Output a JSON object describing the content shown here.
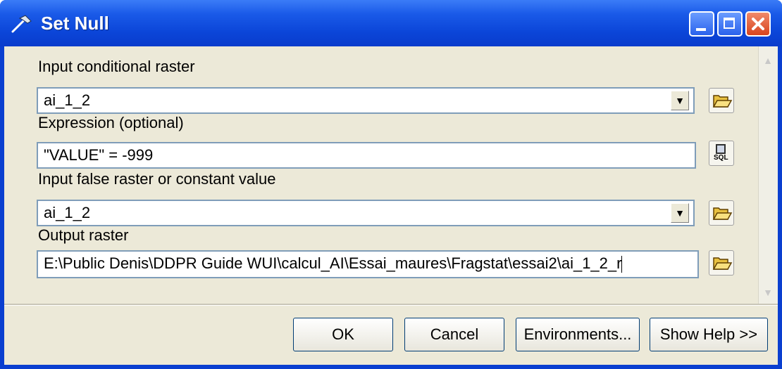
{
  "window": {
    "title": "Set Null"
  },
  "fields": {
    "input_conditional_raster": {
      "label": "Input conditional raster",
      "value": "ai_1_2"
    },
    "expression": {
      "label": "Expression (optional)",
      "value": "\"VALUE\" = -999"
    },
    "input_false_raster": {
      "label": "Input false raster or constant value",
      "value": "ai_1_2"
    },
    "output_raster": {
      "label": "Output raster",
      "value": "E:\\Public Denis\\DDPR Guide WUI\\calcul_AI\\Essai_maures\\Fragstat\\essai2\\ai_1_2_r"
    }
  },
  "buttons": {
    "ok": "OK",
    "cancel": "Cancel",
    "environments": "Environments...",
    "show_help": "Show Help >>"
  },
  "icons": {
    "title": "hammer-icon",
    "browse": "open-folder-icon",
    "sql": "sql-icon",
    "sql_text": "SQL"
  },
  "colors": {
    "titlebar": "#0a3fd0",
    "dialog_bg": "#ece9d8",
    "close_button": "#d8441e"
  }
}
